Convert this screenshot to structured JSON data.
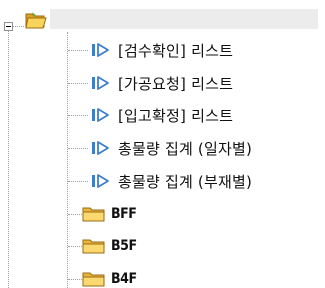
{
  "tree": {
    "root": {
      "label": "",
      "icon": "open-folder-icon",
      "expanded": true
    },
    "items": [
      {
        "label": "[검수확인] 리스트",
        "icon": "play-report-icon"
      },
      {
        "label": "[가공요청] 리스트",
        "icon": "play-report-icon"
      },
      {
        "label": "[입고확정] 리스트",
        "icon": "play-report-icon"
      },
      {
        "label": "총물량 집계 (일자별)",
        "icon": "play-report-icon"
      },
      {
        "label": "총물량 집계 (부재별)",
        "icon": "play-report-icon"
      },
      {
        "label": "BFF",
        "icon": "folder-icon"
      },
      {
        "label": "B5F",
        "icon": "folder-icon"
      },
      {
        "label": "B4F",
        "icon": "folder-icon"
      }
    ]
  },
  "colors": {
    "play_icon": "#3f7fc9",
    "folder_icon": "#f5c542",
    "guide_line": "#a0a0a0"
  }
}
